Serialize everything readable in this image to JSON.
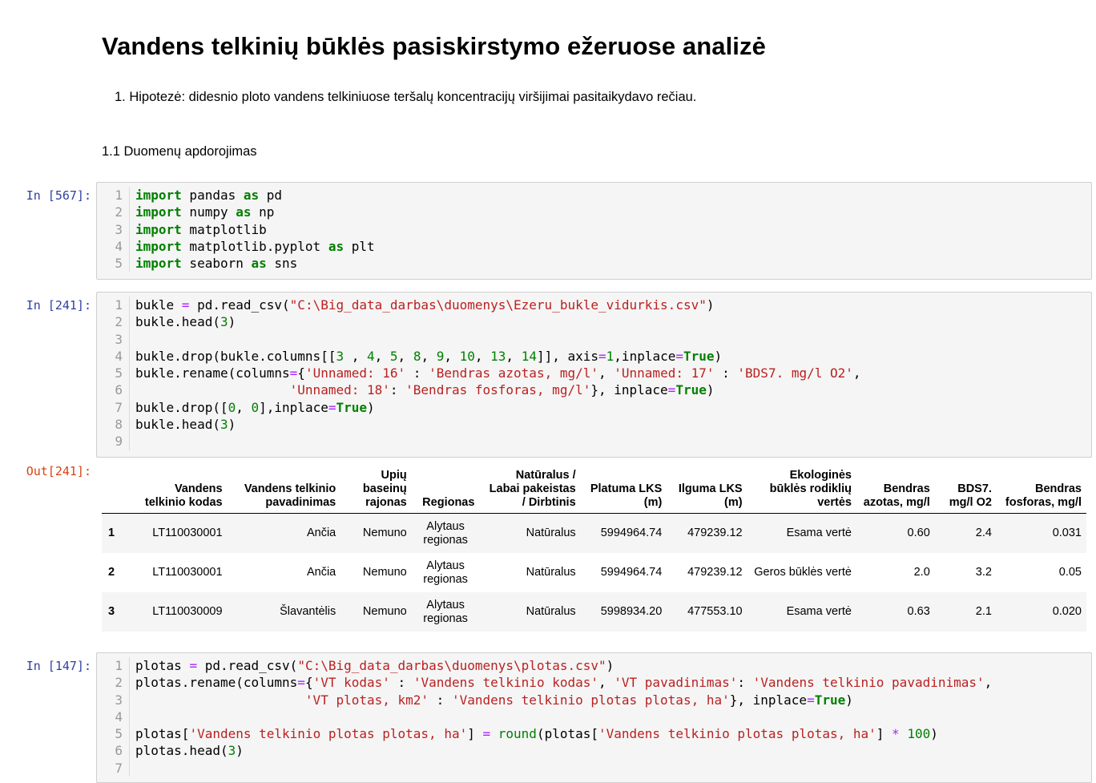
{
  "notebook": {
    "title": "Vandens telkinių būklės pasiskirstymo ežeruose analizė",
    "hypothesis": "1. Hipotezė: didesnio ploto vandens telkiniuose teršalų koncentracijų viršijimai pasitaikydavo rečiau.",
    "subheading": "1.1 Duomenų apdorojimas"
  },
  "cells": [
    {
      "prompt": "In [567]:",
      "lines": [
        [
          [
            "kw",
            "import"
          ],
          [
            "t",
            " pandas "
          ],
          [
            "kw",
            "as"
          ],
          [
            "t",
            " pd"
          ]
        ],
        [
          [
            "kw",
            "import"
          ],
          [
            "t",
            " numpy "
          ],
          [
            "kw",
            "as"
          ],
          [
            "t",
            " np"
          ]
        ],
        [
          [
            "kw",
            "import"
          ],
          [
            "t",
            " matplotlib"
          ]
        ],
        [
          [
            "kw",
            "import"
          ],
          [
            "t",
            " matplotlib.pyplot "
          ],
          [
            "kw",
            "as"
          ],
          [
            "t",
            " plt"
          ]
        ],
        [
          [
            "kw",
            "import"
          ],
          [
            "t",
            " seaborn "
          ],
          [
            "kw",
            "as"
          ],
          [
            "t",
            " sns"
          ]
        ]
      ]
    },
    {
      "prompt": "In [241]:",
      "lines": [
        [
          [
            "t",
            "bukle "
          ],
          [
            "op",
            "="
          ],
          [
            "t",
            " pd.read_csv("
          ],
          [
            "st",
            "\"C:\\Big_data_darbas\\duomenys\\Ezeru_bukle_vidurkis.csv\""
          ],
          [
            "t",
            ")"
          ]
        ],
        [
          [
            "t",
            "bukle.head("
          ],
          [
            "nu",
            "3"
          ],
          [
            "t",
            ")"
          ]
        ],
        [],
        [
          [
            "t",
            "bukle.drop(bukle.columns[["
          ],
          [
            "nu",
            "3"
          ],
          [
            "t",
            " , "
          ],
          [
            "nu",
            "4"
          ],
          [
            "t",
            ", "
          ],
          [
            "nu",
            "5"
          ],
          [
            "t",
            ", "
          ],
          [
            "nu",
            "8"
          ],
          [
            "t",
            ", "
          ],
          [
            "nu",
            "9"
          ],
          [
            "t",
            ", "
          ],
          [
            "nu",
            "10"
          ],
          [
            "t",
            ", "
          ],
          [
            "nu",
            "13"
          ],
          [
            "t",
            ", "
          ],
          [
            "nu",
            "14"
          ],
          [
            "t",
            "]], axis"
          ],
          [
            "op",
            "="
          ],
          [
            "nu",
            "1"
          ],
          [
            "t",
            ",inplace"
          ],
          [
            "op",
            "="
          ],
          [
            "kw",
            "True"
          ],
          [
            "t",
            ")"
          ]
        ],
        [
          [
            "t",
            "bukle.rename(columns"
          ],
          [
            "op",
            "="
          ],
          [
            "t",
            "{"
          ],
          [
            "st",
            "'Unnamed: 16'"
          ],
          [
            "t",
            " : "
          ],
          [
            "st",
            "'Bendras azotas, mg/l'"
          ],
          [
            "t",
            ", "
          ],
          [
            "st",
            "'Unnamed: 17'"
          ],
          [
            "t",
            " : "
          ],
          [
            "st",
            "'BDS7. mg/l O2'"
          ],
          [
            "t",
            ","
          ]
        ],
        [
          [
            "t",
            "                    "
          ],
          [
            "st",
            "'Unnamed: 18'"
          ],
          [
            "t",
            ": "
          ],
          [
            "st",
            "'Bendras fosforas, mg/l'"
          ],
          [
            "t",
            "}, inplace"
          ],
          [
            "op",
            "="
          ],
          [
            "kw",
            "True"
          ],
          [
            "t",
            ")"
          ]
        ],
        [
          [
            "t",
            "bukle.drop(["
          ],
          [
            "nu",
            "0"
          ],
          [
            "t",
            ", "
          ],
          [
            "nu",
            "0"
          ],
          [
            "t",
            "],inplace"
          ],
          [
            "op",
            "="
          ],
          [
            "kw",
            "True"
          ],
          [
            "t",
            ")"
          ]
        ],
        [
          [
            "t",
            "bukle.head("
          ],
          [
            "nu",
            "3"
          ],
          [
            "t",
            ")"
          ]
        ],
        []
      ]
    },
    {
      "prompt": "In [147]:",
      "lines": [
        [
          [
            "t",
            "plotas "
          ],
          [
            "op",
            "="
          ],
          [
            "t",
            " pd.read_csv("
          ],
          [
            "st",
            "\"C:\\Big_data_darbas\\duomenys\\plotas.csv\""
          ],
          [
            "t",
            ")"
          ]
        ],
        [
          [
            "t",
            "plotas.rename(columns"
          ],
          [
            "op",
            "="
          ],
          [
            "t",
            "{"
          ],
          [
            "st",
            "'VT kodas'"
          ],
          [
            "t",
            " : "
          ],
          [
            "st",
            "'Vandens telkinio kodas'"
          ],
          [
            "t",
            ", "
          ],
          [
            "st",
            "'VT pavadinimas'"
          ],
          [
            "t",
            ": "
          ],
          [
            "st",
            "'Vandens telkinio pavadinimas'"
          ],
          [
            "t",
            ","
          ]
        ],
        [
          [
            "t",
            "                      "
          ],
          [
            "st",
            "'VT plotas, km2'"
          ],
          [
            "t",
            " : "
          ],
          [
            "st",
            "'Vandens telkinio plotas plotas, ha'"
          ],
          [
            "t",
            "}, inplace"
          ],
          [
            "op",
            "="
          ],
          [
            "kw",
            "True"
          ],
          [
            "t",
            ")"
          ]
        ],
        [],
        [
          [
            "t",
            "plotas["
          ],
          [
            "st",
            "'Vandens telkinio plotas plotas, ha'"
          ],
          [
            "t",
            "] "
          ],
          [
            "op",
            "="
          ],
          [
            "t",
            " "
          ],
          [
            "nu",
            "round"
          ],
          [
            "t",
            "(plotas["
          ],
          [
            "st",
            "'Vandens telkinio plotas plotas, ha'"
          ],
          [
            "t",
            "] "
          ],
          [
            "op",
            "*"
          ],
          [
            "t",
            " "
          ],
          [
            "nu",
            "100"
          ],
          [
            "t",
            ")"
          ]
        ],
        [
          [
            "t",
            "plotas.head("
          ],
          [
            "nu",
            "3"
          ],
          [
            "t",
            ")"
          ]
        ],
        []
      ]
    }
  ],
  "output": {
    "prompt": "Out[241]:",
    "columns": [
      "",
      "Vandens telkinio kodas",
      "Vandens telkinio pavadinimas",
      "Upių baseinų rajonas",
      "Regionas",
      "Natūralus / Labai pakeistas / Dirbtinis",
      "Platuma LKS (m)",
      "Ilguma LKS (m)",
      "Ekologinės būklės rodiklių vertės",
      "Bendras azotas, mg/l",
      "BDS7. mg/l O2",
      "Bendras fosforas, mg/l"
    ],
    "rows": [
      [
        "1",
        "LT110030001",
        "Ančia",
        "Nemuno",
        "Alytaus regionas",
        "Natūralus",
        "5994964.74",
        "479239.12",
        "Esama vertė",
        "0.60",
        "2.4",
        "0.031"
      ],
      [
        "2",
        "LT110030001",
        "Ančia",
        "Nemuno",
        "Alytaus regionas",
        "Natūralus",
        "5994964.74",
        "479239.12",
        "Geros būklės vertė",
        "2.0",
        "3.2",
        "0.05"
      ],
      [
        "3",
        "LT110030009",
        "Šlavantėlis",
        "Nemuno",
        "Alytaus regionas",
        "Natūralus",
        "5998934.20",
        "477553.10",
        "Esama vertė",
        "0.63",
        "2.1",
        "0.020"
      ]
    ]
  }
}
